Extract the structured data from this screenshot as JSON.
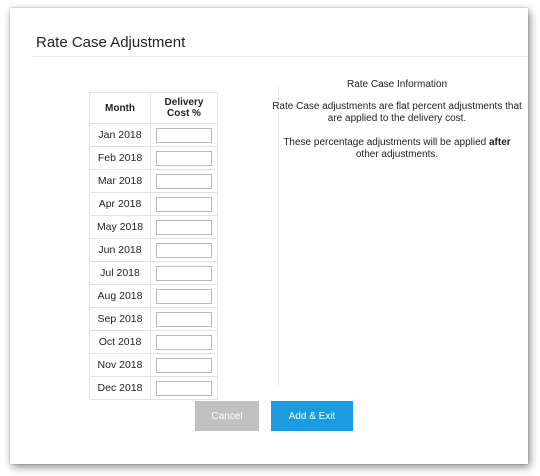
{
  "dialog": {
    "title": "Rate Case Adjustment"
  },
  "table": {
    "headers": {
      "month": "Month",
      "cost_line1": "Delivery",
      "cost_line2": "Cost %"
    },
    "rows": [
      {
        "month": "Jan 2018",
        "value": ""
      },
      {
        "month": "Feb 2018",
        "value": ""
      },
      {
        "month": "Mar 2018",
        "value": ""
      },
      {
        "month": "Apr 2018",
        "value": ""
      },
      {
        "month": "May 2018",
        "value": ""
      },
      {
        "month": "Jun 2018",
        "value": ""
      },
      {
        "month": "Jul 2018",
        "value": ""
      },
      {
        "month": "Aug 2018",
        "value": ""
      },
      {
        "month": "Sep 2018",
        "value": ""
      },
      {
        "month": "Oct 2018",
        "value": ""
      },
      {
        "month": "Nov 2018",
        "value": ""
      },
      {
        "month": "Dec 2018",
        "value": ""
      }
    ]
  },
  "info": {
    "heading": "Rate Case Information",
    "para1": "Rate Case adjustments are flat percent adjustments that are applied to the delivery cost.",
    "para2_before": "These percentage adjustments will be applied ",
    "para2_bold": "after",
    "para2_after": " other adjustments."
  },
  "buttons": {
    "cancel": "Cancel",
    "add_exit": "Add & Exit"
  },
  "colors": {
    "primary_button": "#1a9be0",
    "disabled_button": "#c1c1c1"
  }
}
